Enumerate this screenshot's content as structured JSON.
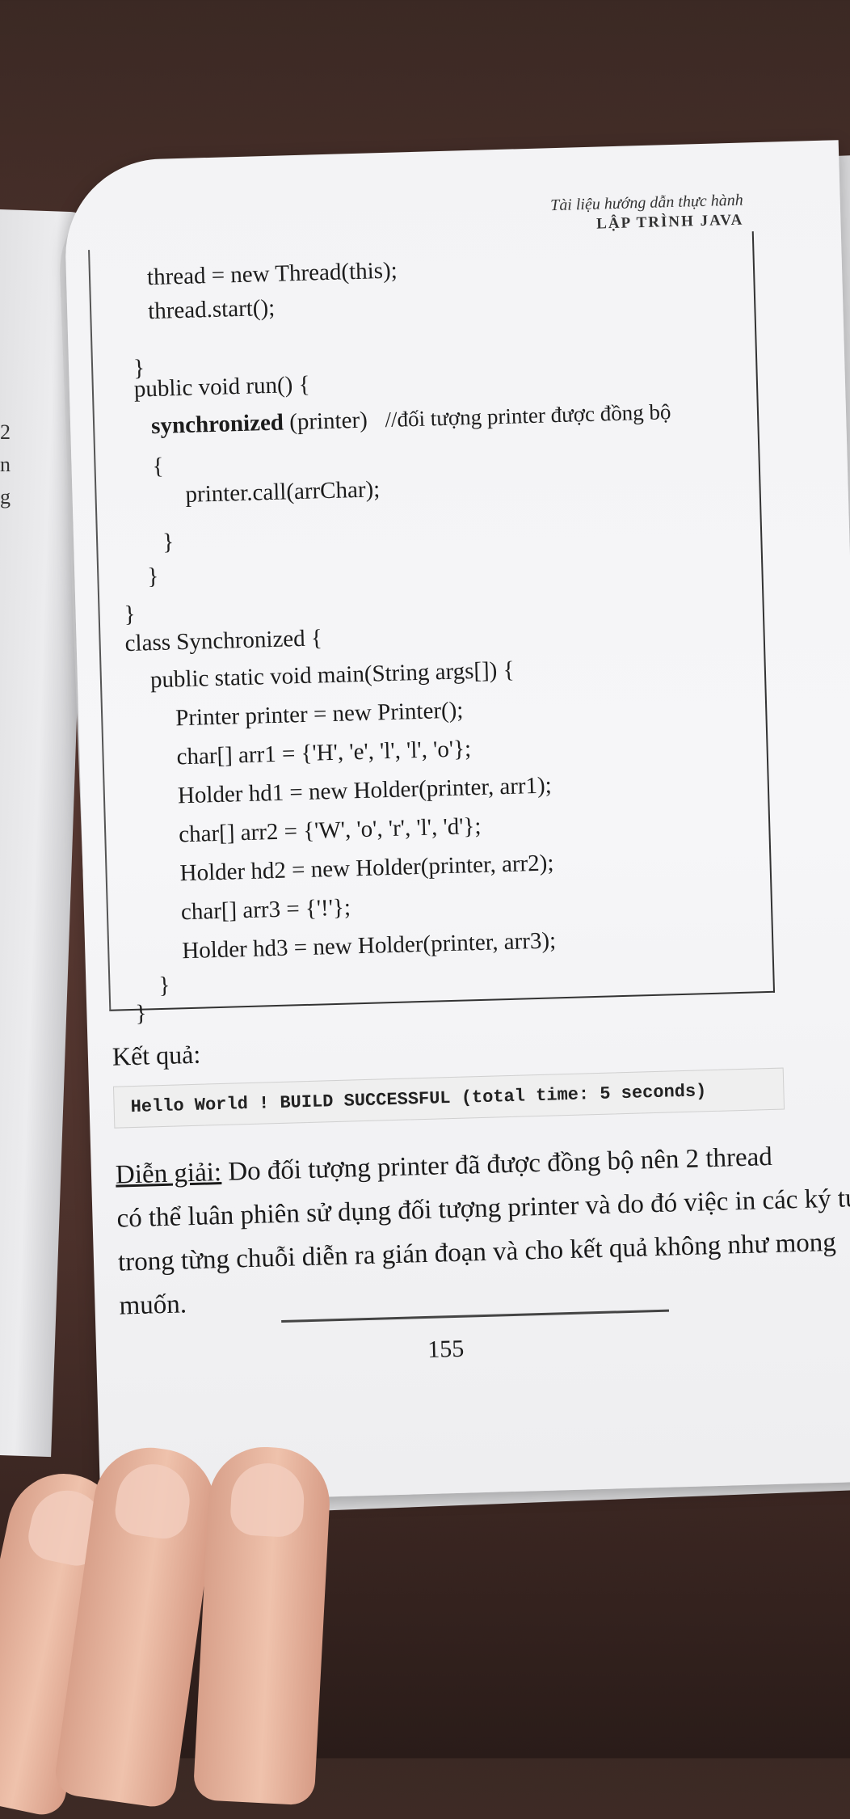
{
  "running_head": {
    "subtitle": "Tài liệu hướng dẫn thực hành",
    "title": "LẬP TRÌNH JAVA"
  },
  "code": {
    "l1": "thread = new Thread(this);",
    "l2": "thread.start();",
    "l3": "}",
    "l4": "public void run() {",
    "l5_kw": "synchronized",
    "l5_rest": " (printer)",
    "l5_comment": "//đối tượng printer được đồng bộ",
    "l6": "{",
    "l7": "printer.call(arrChar);",
    "l8": "}",
    "l9": "}",
    "l10": "}",
    "l11": "class Synchronized {",
    "l12": "public static void main(String args[]) {",
    "l13": "Printer printer = new Printer();",
    "l14": "char[] arr1 = {'H', 'e', 'l', 'l', 'o'};",
    "l15": "Holder hd1 = new Holder(printer, arr1);",
    "l16": "char[] arr2 = {'W', 'o', 'r', 'l', 'd'};",
    "l17": "Holder hd2 = new Holder(printer, arr2);",
    "l18": "char[] arr3 = {'!'};",
    "l19": "Holder hd3 = new Holder(printer, arr3);",
    "l20": "}",
    "l21": "}"
  },
  "result": {
    "label": "Kết quả:",
    "console": "Hello World ! BUILD SUCCESSFUL (total time: 5 seconds)"
  },
  "explanation": {
    "heading": "Diễn giải:",
    "line1": " Do đối tượng printer đã được đồng bộ nên 2 thread",
    "line2": "có thể luân phiên sử dụng đối tượng printer và do đó việc in các ký tự",
    "line3": "trong từng chuỗi diễn ra gián đoạn và cho kết quả không như mong",
    "line4": "muốn."
  },
  "page_number": "155",
  "left_page_chars": [
    "2",
    "n",
    "g"
  ]
}
